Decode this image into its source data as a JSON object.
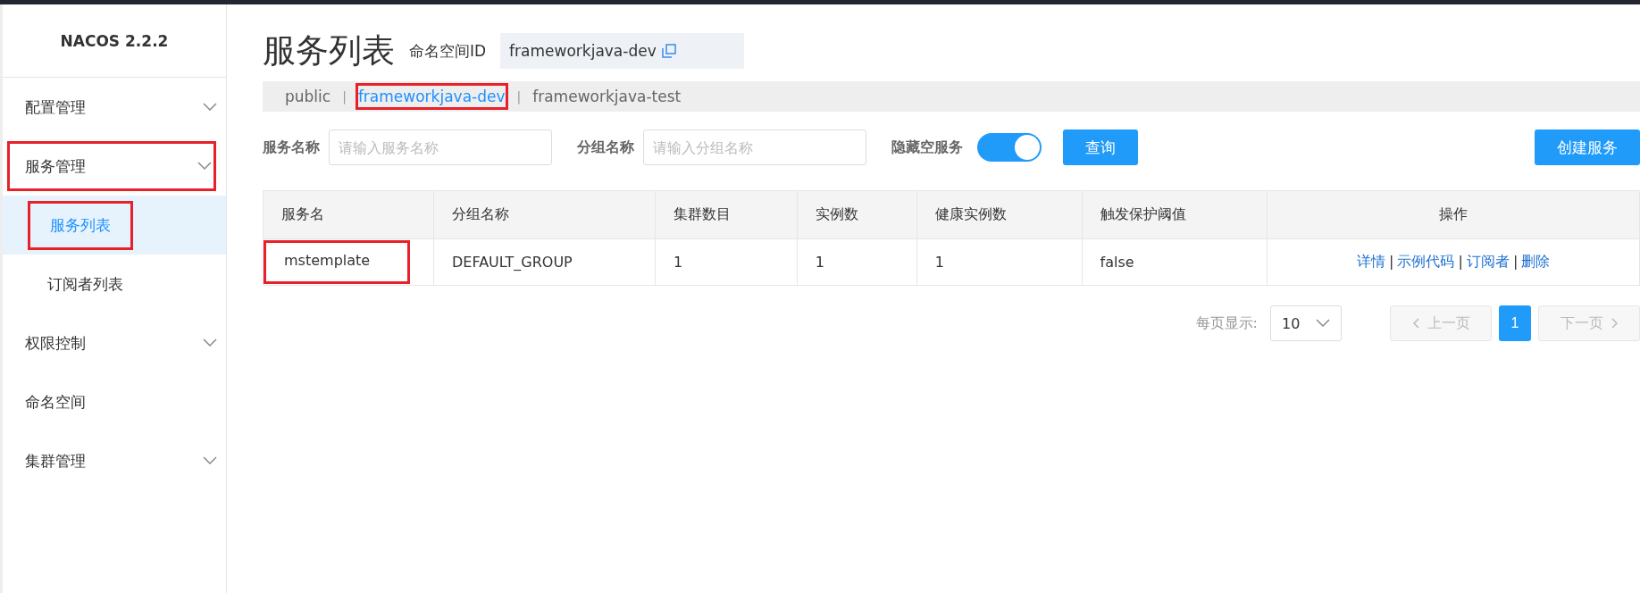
{
  "sidebar": {
    "brand": "NACOS 2.2.2",
    "items": [
      {
        "label": "配置管理",
        "kind": "group",
        "highlighted": false
      },
      {
        "label": "服务管理",
        "kind": "group",
        "highlighted": true,
        "children": [
          {
            "label": "服务列表",
            "selected": true,
            "highlighted": true
          },
          {
            "label": "订阅者列表",
            "selected": false,
            "highlighted": false
          }
        ]
      },
      {
        "label": "权限控制",
        "kind": "group",
        "highlighted": false
      },
      {
        "label": "命名空间",
        "kind": "link",
        "highlighted": false
      },
      {
        "label": "集群管理",
        "kind": "group",
        "highlighted": false
      }
    ]
  },
  "page": {
    "title": "服务列表",
    "namespace_label": "命名空间ID",
    "namespace_value": "frameworkjava-dev"
  },
  "namespaces": [
    {
      "label": "public",
      "selected": false,
      "highlighted": false
    },
    {
      "label": "frameworkjava-dev",
      "selected": true,
      "highlighted": true
    },
    {
      "label": "frameworkjava-test",
      "selected": false,
      "highlighted": false
    }
  ],
  "namespace_separators": [
    "|",
    "|"
  ],
  "filters": {
    "service_label": "服务名称",
    "service_placeholder": "请输入服务名称",
    "group_label": "分组名称",
    "group_placeholder": "请输入分组名称",
    "hide_empty_label": "隐藏空服务",
    "hide_empty_on": true,
    "query_button": "查询",
    "create_button": "创建服务"
  },
  "table": {
    "columns": [
      "服务名",
      "分组名称",
      "集群数目",
      "实例数",
      "健康实例数",
      "触发保护阈值",
      "操作"
    ],
    "rows": [
      {
        "cells": [
          "mstemplate",
          "DEFAULT_GROUP",
          "1",
          "1",
          "1",
          "false"
        ],
        "highlighted": true,
        "actions": [
          "详情",
          "示例代码",
          "订阅者",
          "删除"
        ],
        "action_separators": [
          "|",
          "|",
          "|"
        ]
      }
    ]
  },
  "pagination": {
    "page_size_label": "每页显示:",
    "page_size": "10",
    "prev": "上一页",
    "pages": [
      {
        "label": "1",
        "selected": true
      }
    ],
    "next": "下一页"
  }
}
